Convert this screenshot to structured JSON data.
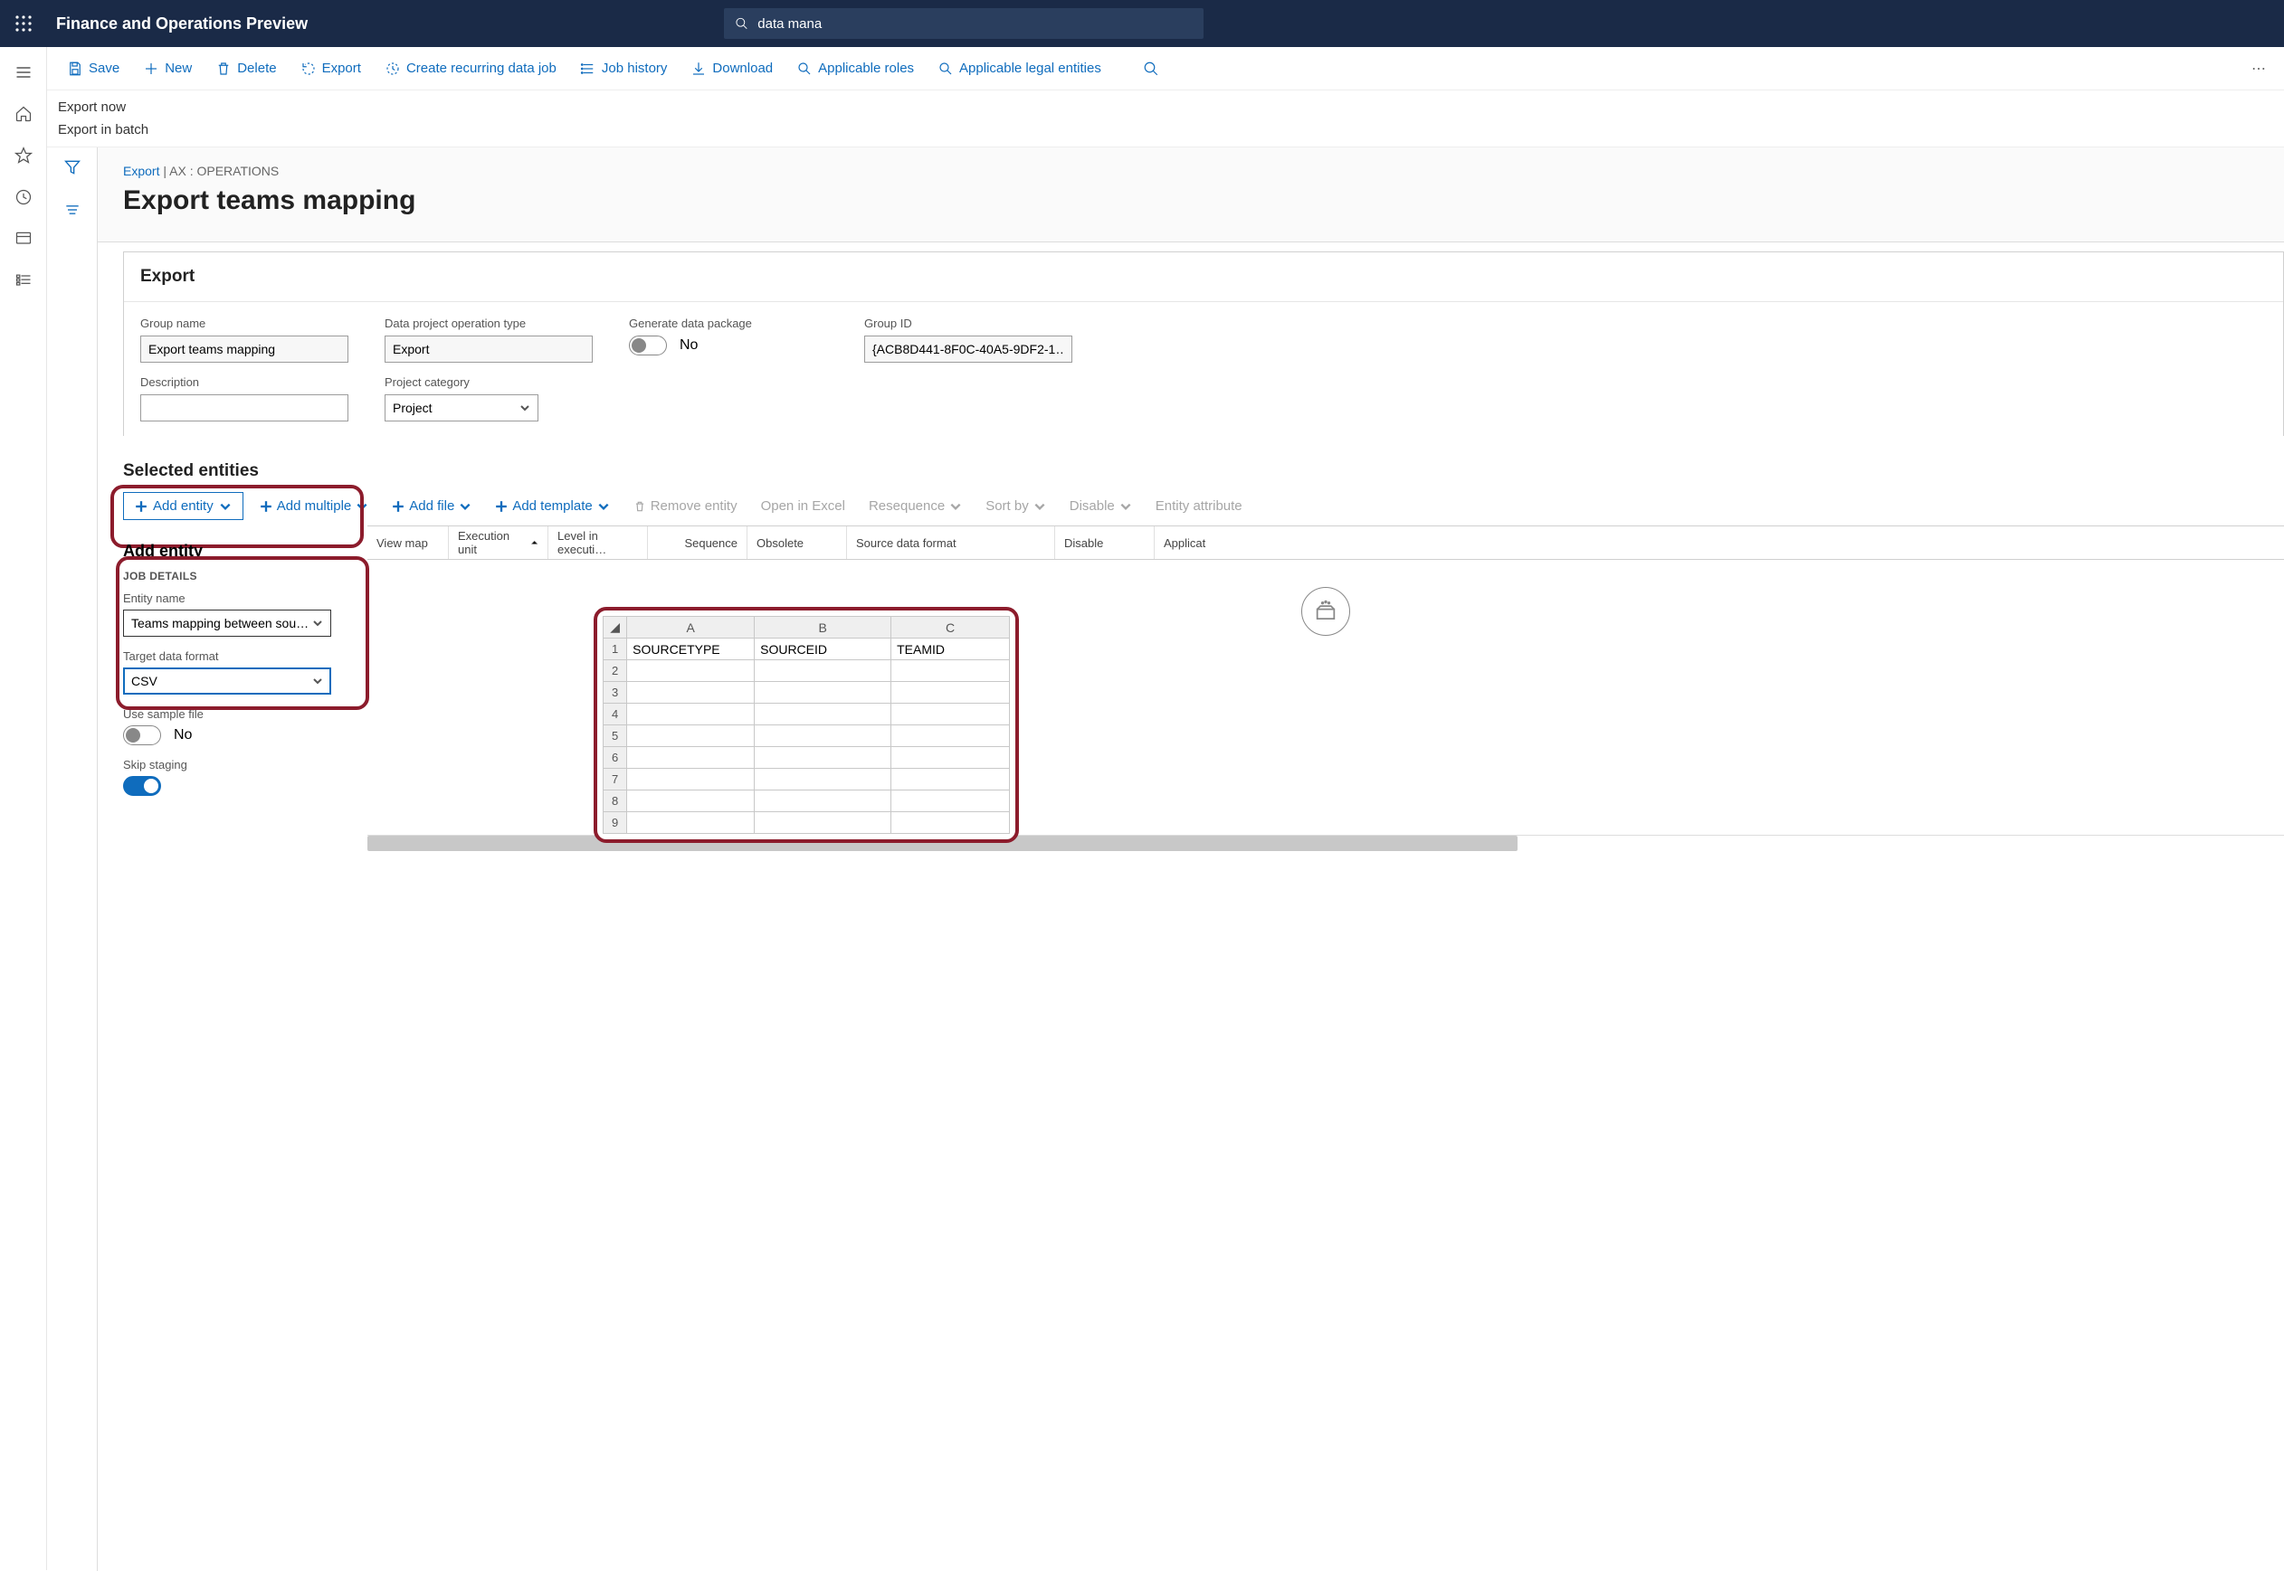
{
  "app_title": "Finance and Operations Preview",
  "search_value": "data mana",
  "cmd_bar": {
    "save": "Save",
    "new": "New",
    "delete": "Delete",
    "export": "Export",
    "recurring": "Create recurring data job",
    "history": "Job history",
    "download": "Download",
    "roles": "Applicable roles",
    "entities": "Applicable legal entities"
  },
  "submenu": {
    "export_now": "Export now",
    "export_batch": "Export in batch"
  },
  "breadcrumb": {
    "link": "Export",
    "rest": "AX : OPERATIONS"
  },
  "page_title": "Export teams mapping",
  "form": {
    "section_title": "Export",
    "group_name_label": "Group name",
    "group_name": "Export teams mapping",
    "operation_type_label": "Data project operation type",
    "operation_type": "Export",
    "generate_label": "Generate data package",
    "generate_value": "No",
    "group_id_label": "Group ID",
    "group_id": "{ACB8D441-8F0C-40A5-9DF2-1…",
    "description_label": "Description",
    "description": "",
    "category_label": "Project category",
    "category": "Project"
  },
  "entities_section": "Selected entities",
  "entity_toolbar": {
    "add_entity": "Add entity",
    "add_multiple": "Add multiple",
    "add_file": "Add file",
    "add_template": "Add template",
    "remove": "Remove entity",
    "open_excel": "Open in Excel",
    "resequence": "Resequence",
    "sort": "Sort by",
    "disable": "Disable",
    "entity_attr": "Entity attribute"
  },
  "grid_columns": {
    "view_map": "View map",
    "exec_unit": "Execution unit",
    "level": "Level in executi…",
    "sequence": "Sequence",
    "obsolete": "Obsolete",
    "source_format": "Source data format",
    "disable": "Disable",
    "applicat": "Applicat"
  },
  "add_panel": {
    "title": "Add entity",
    "sub": "Job Details",
    "entity_name_label": "Entity name",
    "entity_name": "Teams mapping between sou…",
    "target_format_label": "Target data format",
    "target_format": "CSV",
    "use_sample_label": "Use sample file",
    "use_sample_value": "No",
    "skip_staging_label": "Skip staging"
  },
  "chart_data": {
    "type": "table",
    "columns": [
      "A",
      "B",
      "C"
    ],
    "headers_row": [
      "SOURCETYPE",
      "SOURCEID",
      "TEAMID"
    ],
    "rows_visible": [
      1,
      2,
      3,
      4,
      5,
      6,
      7,
      8,
      9
    ]
  }
}
